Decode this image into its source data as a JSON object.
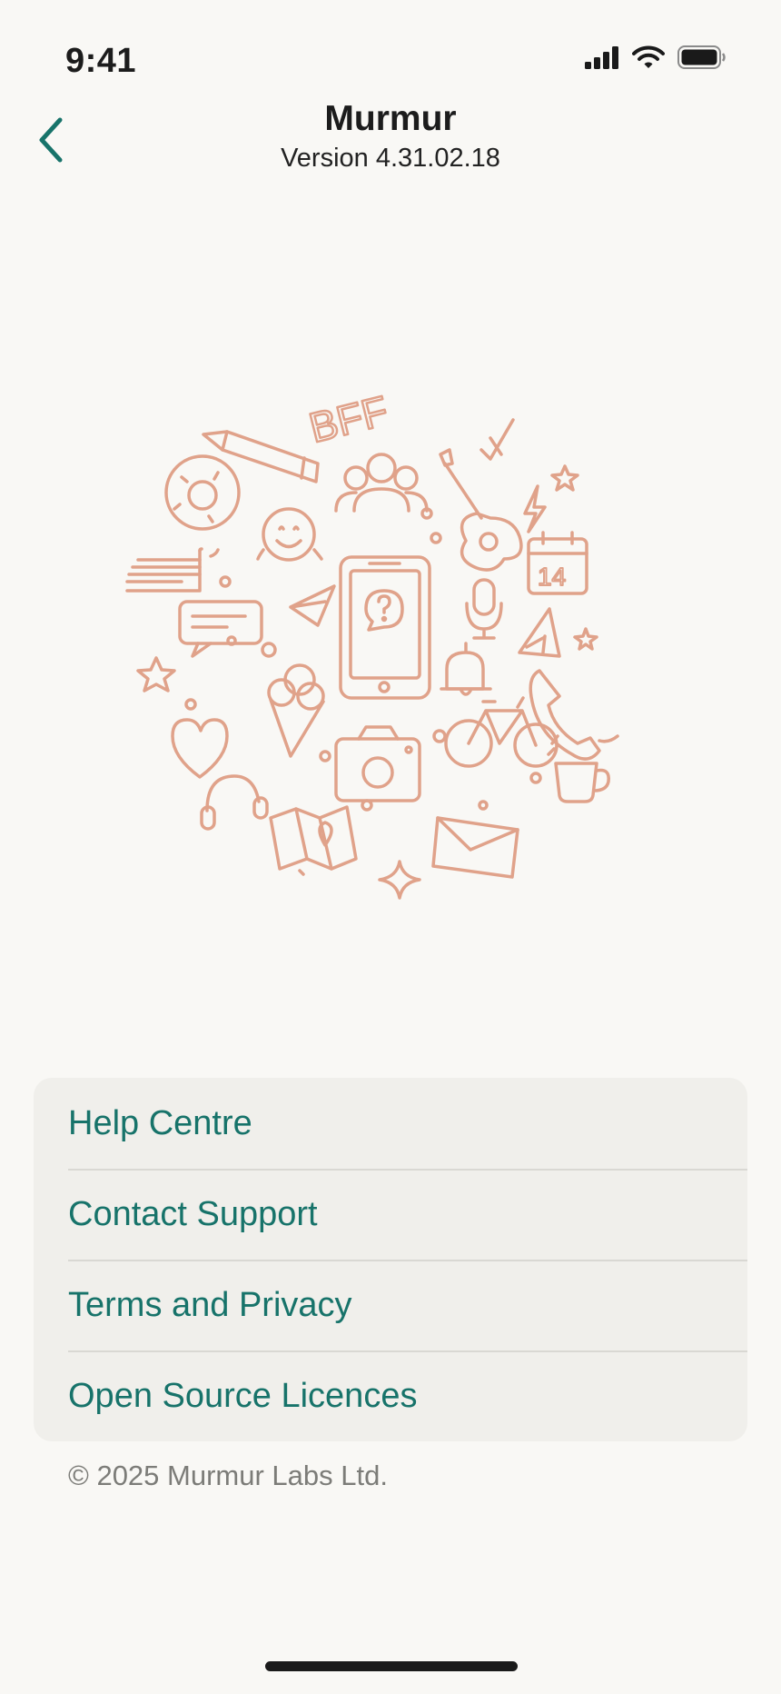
{
  "status_bar": {
    "time": "9:41",
    "icons": [
      "cellular-signal-icon",
      "wifi-icon",
      "battery-icon"
    ]
  },
  "nav": {
    "back_icon": "chevron-left-icon",
    "title": "Murmur",
    "version": "Version 4.31.02.18"
  },
  "illustration": {
    "badge_text": "BFF",
    "calendar_text": "14",
    "stroke_color": "#e0a28a"
  },
  "menu": {
    "items": [
      {
        "label": "Help Centre"
      },
      {
        "label": "Contact Support"
      },
      {
        "label": "Terms and Privacy"
      },
      {
        "label": "Open Source Licences"
      }
    ]
  },
  "footer": {
    "copyright": "© 2025 Murmur Labs Ltd."
  },
  "colors": {
    "accent": "#17736a",
    "background": "#f9f8f5",
    "card": "#f0efeb",
    "illustration": "#e0a28a"
  }
}
